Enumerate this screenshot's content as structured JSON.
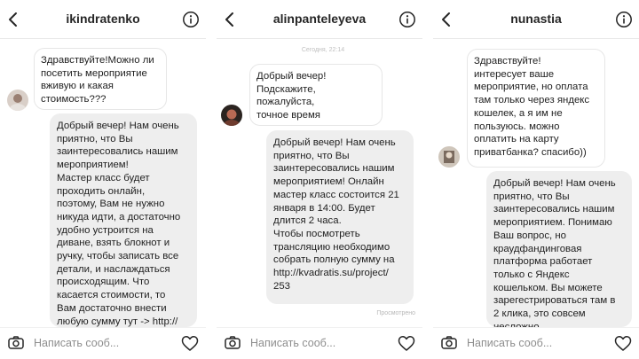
{
  "composer": {
    "placeholder": "Написать сооб..."
  },
  "threads": [
    {
      "username": "ikindratenko",
      "messages": [
        {
          "text": "Здравствуйте!Можно ли\nпосетить мероприятие\nвживую и какая\nстоимость???"
        },
        {
          "text": "Добрый вечер! Нам очень\nприятно, что Вы\nзаинтересовались нашим\nмероприятием!\nМастер класс будет\nпроходить онлайн,\nпоэтому, Вам не нужно\nникуда идти, а достаточно\nудобно устроится на\nдиване, взять блокнот и\nручку, чтобы записать все\nдетали, и наслаждаться\nпроисходящим. Что\nкасается стоимости, то\nВам достаточно внести\nлюбую сумму тут -> http://"
        }
      ]
    },
    {
      "username": "alinpanteleyeva",
      "timestamp": "Сегодня, 22:14",
      "messages": [
        {
          "text": "Добрый вечер!\nПодскажите, пожалуйста,\nточное время проведения\nмероприятия"
        },
        {
          "text": "Добрый вечер! Нам очень\nприятно, что Вы\nзаинтересовались нашим\nмероприятием! Онлайн\nмастер класс состоится 21\nянваря в 14:00. Будет\nдлится 2 часа.\nЧтобы  посмотреть\nтрансляцию необходимо\nсобрать полную сумму на\nhttp://kvadratis.su/project/\n253"
        }
      ],
      "seen": "Просмотрено"
    },
    {
      "username": "nunastia",
      "messages": [
        {
          "text": "Здравствуйте!\nинтересует ваше\nмероприятие, но оплата\nтам только через яндекс\nкошелек, а я им не\nпользуюсь. можно\nоплатить на карту\nприватбанка? спасибо))"
        },
        {
          "text": "Добрый вечер! Нам очень\nприятно, что Вы\nзаинтересовались нашим\nмероприятием. Понимаю\nВаш вопрос, но\nкраудфандинговая\nплатформа работает\nтолько с Яндекс\nкошельком. Вы можете\nзарегестрироваться там в\n2 клика, это совсем\nнесложно"
        }
      ]
    }
  ]
}
